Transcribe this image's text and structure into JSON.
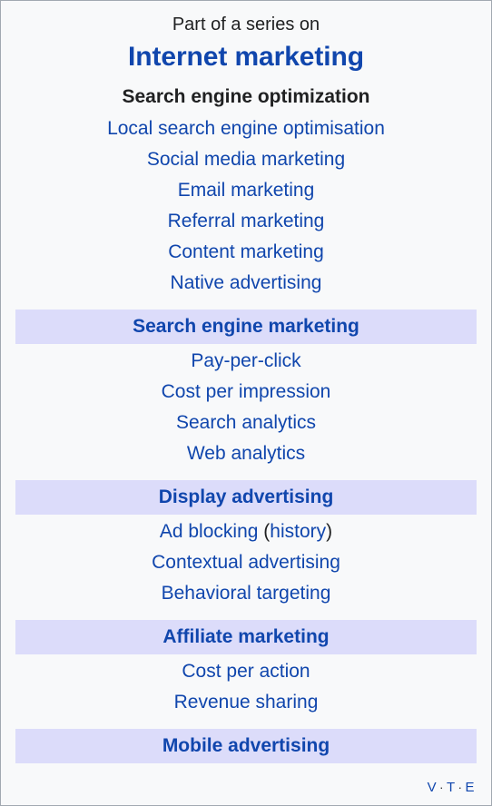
{
  "sidebar": {
    "series_label": "Part of a series on",
    "title": "Internet marketing",
    "colors": {
      "link": "#1046ad",
      "text": "#202122",
      "header_band": "#dcdcfa",
      "background": "#f8f9fa",
      "border": "#a2a9b1"
    },
    "groups": [
      {
        "header": null,
        "items": [
          {
            "text": "Search engine optimization",
            "type": "current"
          },
          {
            "text": "Local search engine optimisation",
            "type": "link"
          },
          {
            "text": "Social media marketing",
            "type": "link"
          },
          {
            "text": "Email marketing",
            "type": "link"
          },
          {
            "text": "Referral marketing",
            "type": "link"
          },
          {
            "text": "Content marketing",
            "type": "link"
          },
          {
            "text": "Native advertising",
            "type": "link"
          }
        ]
      },
      {
        "header": "Search engine marketing",
        "items": [
          {
            "text": "Pay-per-click",
            "type": "link"
          },
          {
            "text": "Cost per impression",
            "type": "link"
          },
          {
            "text": "Search analytics",
            "type": "link"
          },
          {
            "text": "Web analytics",
            "type": "link"
          }
        ]
      },
      {
        "header": "Display advertising",
        "items": [
          {
            "type": "link-with-paren",
            "text": "Ad blocking",
            "paren_open": "(",
            "paren_text": "history",
            "paren_close": ")"
          },
          {
            "text": "Contextual advertising",
            "type": "link"
          },
          {
            "text": "Behavioral targeting",
            "type": "link"
          }
        ]
      },
      {
        "header": "Affiliate marketing",
        "items": [
          {
            "text": "Cost per action",
            "type": "link"
          },
          {
            "text": "Revenue sharing",
            "type": "link"
          }
        ]
      },
      {
        "header": "Mobile advertising",
        "items": []
      }
    ],
    "navbar": {
      "view": "v",
      "talk": "t",
      "edit": "e",
      "separator": "·"
    }
  }
}
